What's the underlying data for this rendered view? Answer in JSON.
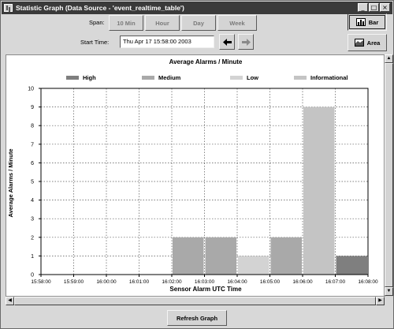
{
  "window": {
    "title": "Statistic Graph (Data Source - 'event_realtime_table')",
    "controls": [
      "_",
      "□",
      "×"
    ]
  },
  "span": {
    "label": "Span:",
    "options": [
      "10 Min",
      "Hour",
      "Day",
      "Week"
    ]
  },
  "start_time": {
    "label": "Start Time:",
    "value": "Thu Apr 17 15:58:00 2003",
    "prev_icon": "left-arrow-icon",
    "next_icon": "right-arrow-icon"
  },
  "view_buttons": {
    "bar": "Bar",
    "area": "Area",
    "selected": "bar"
  },
  "refresh_label": "Refresh Graph",
  "colors": {
    "high": "#7f7f7f",
    "medium": "#a9a9a9",
    "low": "#d3d3d3",
    "informational": "#c4c4c4"
  },
  "chart_data": {
    "type": "bar",
    "title": "Average Alarms / Minute",
    "xlabel": "Sensor Alarm UTC Time",
    "ylabel": "Average Alarms / Minute",
    "ylim": [
      0,
      10
    ],
    "yticks": [
      "0",
      "1",
      "2",
      "3",
      "4",
      "5",
      "6",
      "7",
      "8",
      "9",
      "10"
    ],
    "categories": [
      "15:58:00",
      "15:59:00",
      "16:00:00",
      "16:01:00",
      "16:02:00",
      "16:03:00",
      "16:04:00",
      "16:05:00",
      "16:06:00",
      "16:07:00",
      "16:08:00"
    ],
    "legend": [
      {
        "name": "High",
        "color_key": "high"
      },
      {
        "name": "Medium",
        "color_key": "medium"
      },
      {
        "name": "Low",
        "color_key": "low"
      },
      {
        "name": "Informational",
        "color_key": "informational"
      }
    ],
    "bars": [
      {
        "start": "16:02:00",
        "series": "Medium",
        "value": 2
      },
      {
        "start": "16:03:00",
        "series": "Medium",
        "value": 2
      },
      {
        "start": "16:04:00",
        "series": "Low",
        "value": 1
      },
      {
        "start": "16:05:00",
        "series": "Medium",
        "value": 2
      },
      {
        "start": "16:06:00",
        "series": "Informational",
        "value": 9
      },
      {
        "start": "16:07:00",
        "series": "High",
        "value": 1
      }
    ],
    "grid": true,
    "legend_position": "top"
  }
}
